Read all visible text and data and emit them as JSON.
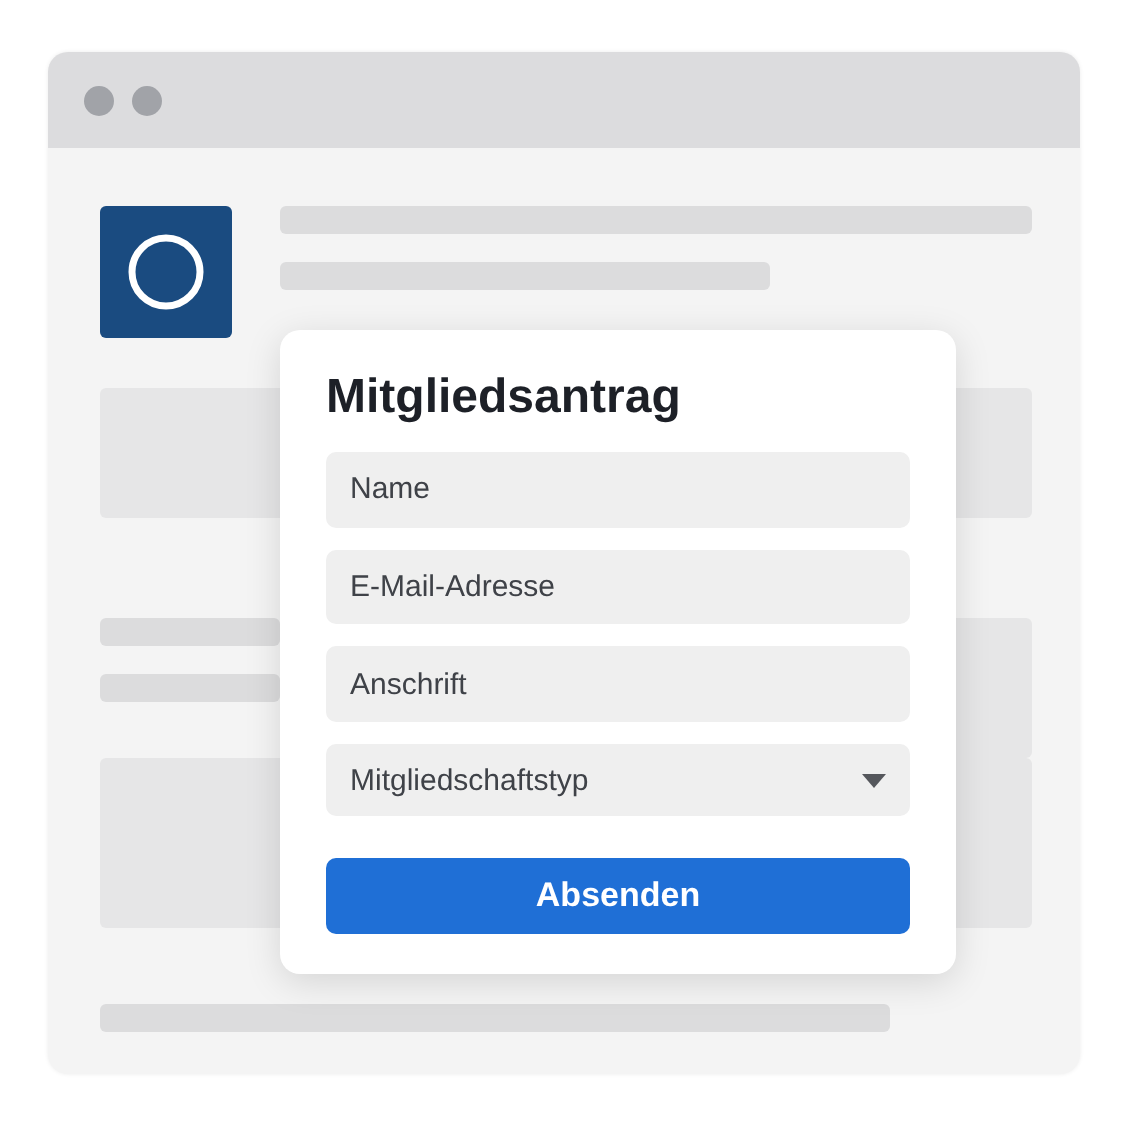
{
  "dialog": {
    "title": "Mitgliedsantrag",
    "fields": [
      {
        "kind": "text",
        "placeholder": "Name"
      },
      {
        "kind": "text",
        "placeholder": "E-Mail-Adresse"
      },
      {
        "kind": "text",
        "placeholder": "Anschrift"
      },
      {
        "kind": "select",
        "placeholder": "Mitgliedschaftstyp"
      }
    ],
    "submit": "Absenden"
  }
}
